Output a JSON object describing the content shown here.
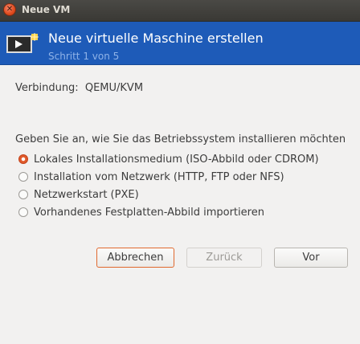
{
  "window": {
    "title": "Neue VM"
  },
  "header": {
    "title": "Neue virtuelle Maschine erstellen",
    "step": "Schritt 1 von 5",
    "icon": "monitor-play-icon"
  },
  "connection": {
    "label": "Verbindung:",
    "value": "QEMU/KVM"
  },
  "question": "Geben Sie an, wie Sie das Betriebssystem installieren möchten",
  "options": [
    {
      "label": "Lokales Installationsmedium (ISO-Abbild oder CDROM)",
      "selected": true
    },
    {
      "label": "Installation vom Netzwerk (HTTP, FTP oder NFS)",
      "selected": false
    },
    {
      "label": "Netzwerkstart (PXE)",
      "selected": false
    },
    {
      "label": "Vorhandenes Festplatten-Abbild importieren",
      "selected": false
    }
  ],
  "buttons": {
    "cancel": "Abbrechen",
    "back": "Zurück",
    "next": "Vor"
  },
  "colors": {
    "header_bg": "#1e5bb8",
    "accent": "#e05a2b",
    "titlebar": "#3a3935"
  }
}
